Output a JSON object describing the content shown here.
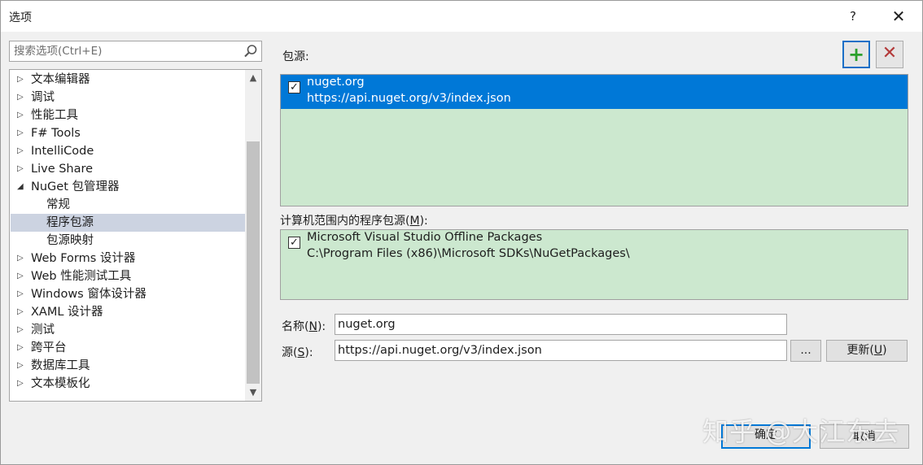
{
  "window": {
    "title": "选项",
    "help": "?",
    "close": "✕"
  },
  "search": {
    "placeholder": "搜索选项(Ctrl+E)"
  },
  "tree": [
    {
      "label": "文本编辑器",
      "expanded": false
    },
    {
      "label": "调试",
      "expanded": false
    },
    {
      "label": "性能工具",
      "expanded": false
    },
    {
      "label": "F# Tools",
      "expanded": false
    },
    {
      "label": "IntelliCode",
      "expanded": false
    },
    {
      "label": "Live Share",
      "expanded": false
    },
    {
      "label": "NuGet 包管理器",
      "expanded": true
    },
    {
      "label": "常规",
      "child": true
    },
    {
      "label": "程序包源",
      "child": true,
      "selected": true
    },
    {
      "label": "包源映射",
      "child": true
    },
    {
      "label": "Web Forms 设计器",
      "expanded": false
    },
    {
      "label": "Web 性能测试工具",
      "expanded": false
    },
    {
      "label": "Windows 窗体设计器",
      "expanded": false
    },
    {
      "label": "XAML 设计器",
      "expanded": false
    },
    {
      "label": "测试",
      "expanded": false
    },
    {
      "label": "跨平台",
      "expanded": false
    },
    {
      "label": "数据库工具",
      "expanded": false
    },
    {
      "label": "文本模板化",
      "expanded": false
    }
  ],
  "sources_label": "包源:",
  "sources": [
    {
      "name": "nuget.org",
      "url": "https://api.nuget.org/v3/index.json",
      "checked": true,
      "selected": true
    }
  ],
  "machine_sources_label_prefix": "计算机范围内的程序包源(",
  "machine_sources_label_key": "M",
  "machine_sources_label_suffix": "):",
  "machine_sources": [
    {
      "name": "Microsoft Visual Studio Offline Packages",
      "url": "C:\\Program Files (x86)\\Microsoft SDKs\\NuGetPackages\\",
      "checked": true
    }
  ],
  "form": {
    "name_label_prefix": "名称(",
    "name_label_key": "N",
    "name_label_suffix": "):",
    "name_value": "nuget.org",
    "source_label_prefix": "源(",
    "source_label_key": "S",
    "source_label_suffix": "):",
    "source_value": "https://api.nuget.org/v3/index.json",
    "browse_label": "...",
    "update_label_prefix": "更新(",
    "update_label_key": "U",
    "update_label_suffix": ")"
  },
  "footer": {
    "ok_label": "确定",
    "cancel_label": "取消"
  },
  "watermark": "知乎 @大江东去",
  "colors": {
    "selection": "#0078d7",
    "list_bg": "#cce8cf",
    "tree_selection": "#ccd3e1",
    "add_icon": "#2ca02c",
    "delete_icon": "#b33a3a"
  }
}
